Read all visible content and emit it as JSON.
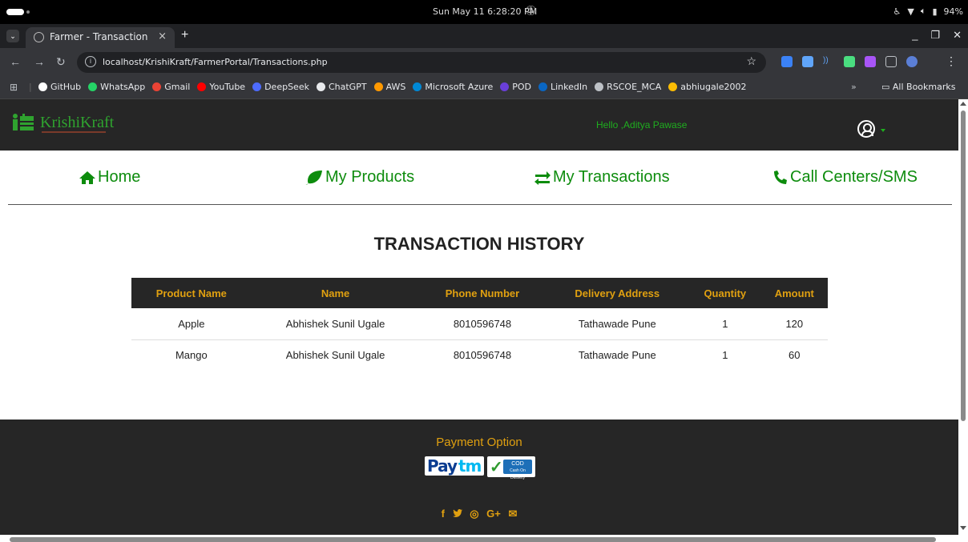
{
  "os": {
    "clock": "Sun May 11   6:28:20 PM",
    "battery": "94%"
  },
  "browser": {
    "tab_title": "Farmer - Transaction",
    "tab_close": "×",
    "new_tab": "+",
    "url": "localhost/KrishiKraft/FarmerPortal/Transactions.php",
    "bookmarks": [
      {
        "label": "GitHub",
        "color": "#ffffff"
      },
      {
        "label": "WhatsApp",
        "color": "#25d366"
      },
      {
        "label": "Gmail",
        "color": "#ea4335"
      },
      {
        "label": "YouTube",
        "color": "#ff0000"
      },
      {
        "label": "DeepSeek",
        "color": "#4d6bfe"
      },
      {
        "label": "ChatGPT",
        "color": "#e8eaed"
      },
      {
        "label": "AWS",
        "color": "#ff9900"
      },
      {
        "label": "Microsoft Azure",
        "color": "#0089d6"
      },
      {
        "label": "POD",
        "color": "#6a3fd8"
      },
      {
        "label": "LinkedIn",
        "color": "#0a66c2"
      },
      {
        "label": "RSCOE_MCA",
        "color": "#bdc1c6"
      },
      {
        "label": "abhiugale2002",
        "color": "#fbbc04"
      }
    ],
    "bookmarks_more": "»",
    "all_bookmarks": "All Bookmarks"
  },
  "site": {
    "logo": "KrishiKraft",
    "greeting": "Hello ,Aditya Pawase",
    "nav": [
      {
        "label": "Home",
        "icon": "home-icon"
      },
      {
        "label": "My Products",
        "icon": "leaf-icon"
      },
      {
        "label": "My Transactions",
        "icon": "exchange-icon"
      },
      {
        "label": "Call Centers/SMS",
        "icon": "phone-icon"
      }
    ],
    "accent": "#0d8c0d",
    "gold": "#e0a010"
  },
  "main": {
    "title": "TRANSACTION HISTORY",
    "columns": [
      "Product Name",
      "Name",
      "Phone Number",
      "Delivery Address",
      "Quantity",
      "Amount"
    ],
    "rows": [
      [
        "Apple",
        "Abhishek Sunil Ugale",
        "8010596748",
        "Tathawade Pune",
        "1",
        "120"
      ],
      [
        "Mango",
        "Abhishek Sunil Ugale",
        "8010596748",
        "Tathawade Pune",
        "1",
        "60"
      ]
    ]
  },
  "footer": {
    "payment_title": "Payment Option",
    "paytm_pay": "Pay",
    "paytm_tm": "tm",
    "cod_label": "COD",
    "cod_sub": "Cash On Delivery",
    "socials": [
      "f",
      "t",
      "◎",
      "G+",
      "✉"
    ]
  }
}
